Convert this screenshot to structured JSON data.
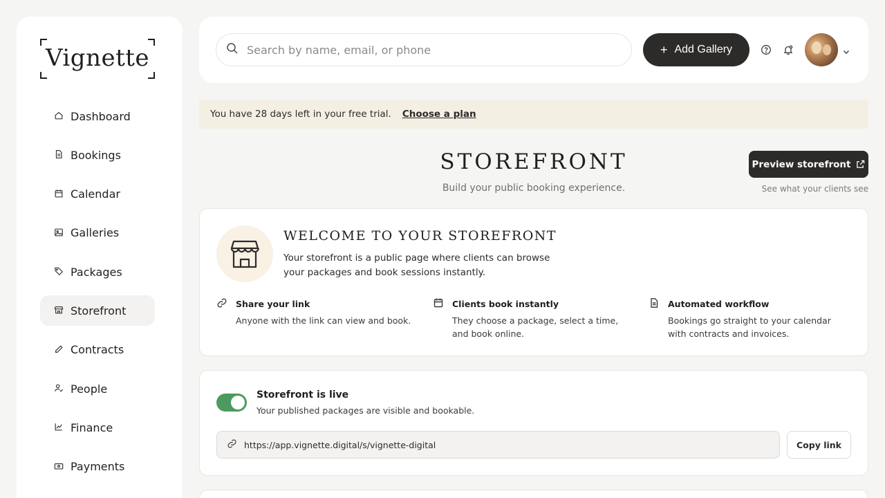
{
  "brand": {
    "logo_text": "Vignette"
  },
  "sidebar": {
    "items": [
      {
        "label": "Dashboard",
        "icon": "home-icon"
      },
      {
        "label": "Bookings",
        "icon": "document-icon"
      },
      {
        "label": "Calendar",
        "icon": "calendar-icon"
      },
      {
        "label": "Galleries",
        "icon": "image-icon"
      },
      {
        "label": "Packages",
        "icon": "tag-icon"
      },
      {
        "label": "Storefront",
        "icon": "store-icon",
        "active": true
      },
      {
        "label": "Contracts",
        "icon": "pen-icon"
      },
      {
        "label": "People",
        "icon": "user-check-icon"
      },
      {
        "label": "Finance",
        "icon": "chart-line-icon"
      },
      {
        "label": "Payments",
        "icon": "banknote-icon"
      }
    ]
  },
  "header": {
    "search_placeholder": "Search by name, email, or phone",
    "add_gallery_label": "Add Gallery",
    "icons": [
      "help-circle-icon",
      "notification-bell-icon",
      "chevron-down-icon"
    ]
  },
  "trial_banner": {
    "message": "You have 28 days left in your free trial.",
    "link_label": "Choose a plan"
  },
  "page": {
    "title": "STOREFRONT",
    "subtitle": "Build your public booking experience.",
    "preview_button_label": "Preview storefront",
    "preview_note": "See what your clients see"
  },
  "welcome": {
    "title": "WELCOME TO YOUR STOREFRONT",
    "description": "Your storefront is a public page where clients can browse your packages and book sessions instantly.",
    "features": [
      {
        "icon": "link-icon",
        "title": "Share your link",
        "description": "Anyone with the link can view and book."
      },
      {
        "icon": "calendar-icon",
        "title": "Clients book instantly",
        "description": "They choose a package, select a time, and book online."
      },
      {
        "icon": "document-icon",
        "title": "Automated workflow",
        "description": "Bookings go straight to your calendar with contracts and invoices."
      }
    ]
  },
  "live_status": {
    "enabled": true,
    "title": "Storefront is live",
    "description": "Your published packages are visible and bookable.",
    "url": "https://app.vignette.digital/s/vignette-digital",
    "copy_label": "Copy link"
  },
  "colors": {
    "background": "#f5f5f4",
    "accent_dark": "#2d2b29",
    "banner_bg": "#f4efe3",
    "toggle_on": "#4c9a5f",
    "badge_bg": "#f8f1e4"
  }
}
